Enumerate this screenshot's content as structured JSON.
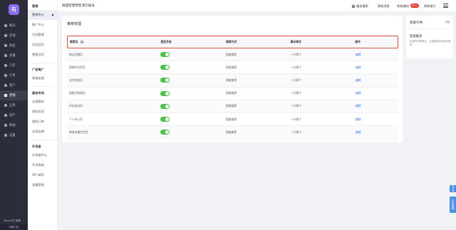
{
  "sidebar": {
    "logo_text": "有",
    "items": [
      {
        "label": "概况",
        "icon": "home-icon",
        "active": false
      },
      {
        "label": "店铺",
        "icon": "shop-icon",
        "active": false
      },
      {
        "label": "商品",
        "icon": "goods-icon",
        "active": false
      },
      {
        "label": "直播",
        "icon": "live-icon",
        "active": false
      },
      {
        "label": "门店",
        "icon": "store-icon",
        "active": false
      },
      {
        "label": "订单",
        "icon": "order-icon",
        "active": false
      },
      {
        "label": "客户",
        "icon": "customer-icon",
        "active": false
      },
      {
        "label": "营销",
        "icon": "marketing-icon",
        "active": true
      },
      {
        "label": "应用",
        "icon": "apps-icon",
        "active": false
      },
      {
        "label": "资产",
        "icon": "asset-icon",
        "active": false
      },
      {
        "label": "数据",
        "icon": "data-icon",
        "active": false
      },
      {
        "label": "设置",
        "icon": "settings-icon",
        "active": false
      }
    ],
    "footer": "Woosh在 搭建",
    "bottom": "切换门店"
  },
  "submenu": {
    "groups": [
      {
        "title": "营销",
        "items": [
          "营销中心",
          "推广中心",
          "活动管理",
          "活动日历",
          "营销日历"
        ],
        "active": "营销中心"
      },
      {
        "title": "广告推广",
        "items": [
          "渠道加速"
        ]
      },
      {
        "title": "服务市场",
        "items": [
          "全部服务",
          "我的应用",
          "我的订单",
          "应用店铺"
        ]
      },
      {
        "title": "开发者",
        "items": [
          "开发者中心",
          "开发指南",
          "API 调用",
          "流量管理"
        ]
      }
    ]
  },
  "topbar": {
    "title": "微盟智慧零售演示账号",
    "search_label": "服务搜索",
    "links": [
      "帮助消息",
      "系统通知",
      "帮助指引"
    ],
    "notification_count": "99+"
  },
  "card": {
    "title": "推荐管理",
    "columns": [
      "推荐位",
      "是否开启",
      "推荐方式",
      "展示样式",
      "操作"
    ],
    "rows": [
      {
        "name": "商品详情页",
        "enabled": true,
        "method": "智能推荐",
        "style": "一行两个",
        "action": "编辑"
      },
      {
        "name": "购物车空空页",
        "enabled": true,
        "method": "智能推荐",
        "style": "一行两个",
        "action": "编辑"
      },
      {
        "name": "支付完成页",
        "enabled": true,
        "method": "智能推荐",
        "style": "一行两个",
        "action": "编辑"
      },
      {
        "name": "搜索空结果页",
        "enabled": true,
        "method": "智能推荐",
        "style": "一行两个",
        "action": "编辑"
      },
      {
        "name": "评论成功页",
        "enabled": true,
        "method": "智能推荐",
        "style": "一行两个",
        "action": "编辑"
      },
      {
        "name": "个人中心页",
        "enabled": true,
        "method": "智能推荐",
        "style": "一行两个",
        "action": "编辑"
      },
      {
        "name": "物流详情空空页",
        "enabled": true,
        "method": "智能推荐",
        "style": "一行两个",
        "action": "编辑"
      }
    ]
  },
  "help_panel": {
    "title": "帮助引导",
    "close_label": "收起",
    "subtitle": "智能推荐",
    "description": "店铺内的推荐位，让智能算法来进行推荐"
  },
  "side_tabs": [
    "意见反馈",
    "在线客服"
  ],
  "colors": {
    "accent": "#8c6cf0",
    "toggle_on": "#4cc14c",
    "link": "#3b7cf3",
    "highlight": "#e14b3f"
  }
}
